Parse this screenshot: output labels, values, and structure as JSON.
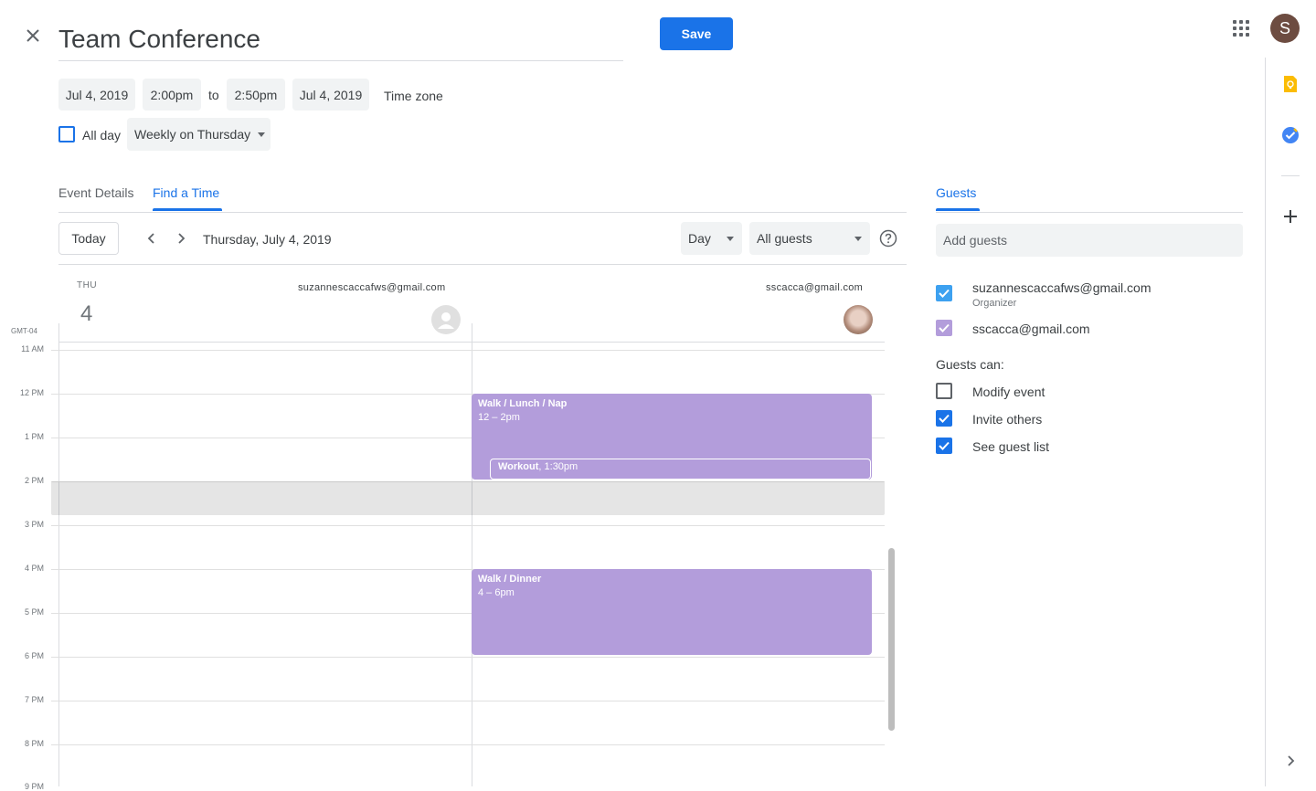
{
  "header": {
    "title": "Team Conference",
    "save_label": "Save",
    "avatar_letter": "S"
  },
  "datetime": {
    "start_date": "Jul 4, 2019",
    "start_time": "2:00pm",
    "to_label": "to",
    "end_time": "2:50pm",
    "end_date": "Jul 4, 2019",
    "timezone_label": "Time zone",
    "all_day_label": "All day",
    "recurrence": "Weekly on Thursday"
  },
  "tabs": {
    "event_details": "Event Details",
    "find_a_time": "Find a Time",
    "active": "find_a_time"
  },
  "toolbar": {
    "today_label": "Today",
    "current_date": "Thursday, July 4, 2019",
    "view_select": "Day",
    "guests_select": "All guests"
  },
  "calendar": {
    "day_abbrev": "THU",
    "day_number": "4",
    "timezone": "GMT-04",
    "columns": [
      {
        "email": "suzannescaccafws@gmail.com"
      },
      {
        "email": "sscacca@gmail.com"
      }
    ],
    "hours": [
      "11 AM",
      "12 PM",
      "1 PM",
      "2 PM",
      "3 PM",
      "4 PM",
      "5 PM",
      "6 PM",
      "7 PM",
      "8 PM",
      "9 PM"
    ],
    "events": [
      {
        "title": "Walk / Lunch / Nap",
        "time": "12 – 2pm"
      },
      {
        "title": "Workout",
        "time": ", 1:30pm"
      },
      {
        "title": "Walk / Dinner",
        "time": "4 – 6pm"
      }
    ]
  },
  "guests": {
    "tab_label": "Guests",
    "add_placeholder": "Add guests",
    "list": [
      {
        "email": "suzannescaccafws@gmail.com",
        "role": "Organizer"
      },
      {
        "email": "sscacca@gmail.com",
        "role": ""
      }
    ],
    "permissions_title": "Guests can:",
    "permissions": [
      {
        "label": "Modify event",
        "checked": false
      },
      {
        "label": "Invite others",
        "checked": true
      },
      {
        "label": "See guest list",
        "checked": true
      }
    ]
  },
  "colors": {
    "primary": "#1a73e8",
    "event": "#b39ddb",
    "keep": "#fbbc04",
    "tasks": "#4285f4"
  },
  "icons": [
    "close-icon",
    "apps-icon",
    "chevron-left-icon",
    "chevron-right-icon",
    "dropdown-caret-icon",
    "help-icon",
    "person-placeholder-icon",
    "keep-icon",
    "tasks-icon",
    "plus-icon",
    "chevron-right-icon"
  ]
}
